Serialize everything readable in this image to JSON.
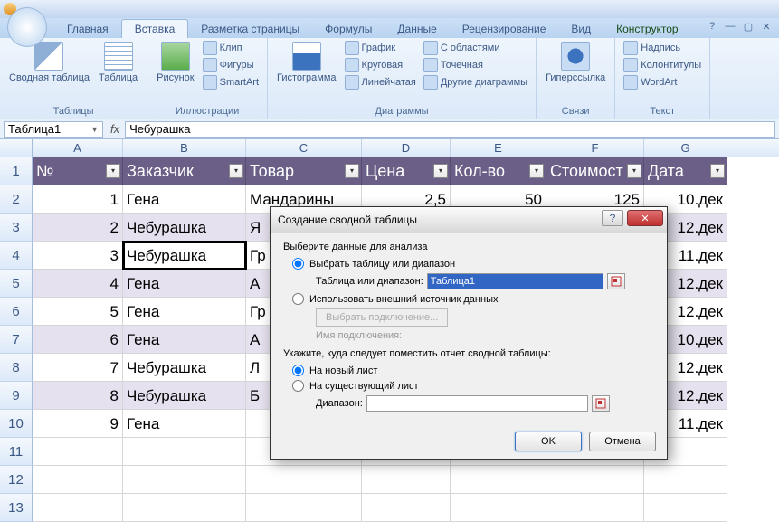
{
  "tabs": [
    "Главная",
    "Вставка",
    "Разметка страницы",
    "Формулы",
    "Данные",
    "Рецензирование",
    "Вид",
    "Конструктор"
  ],
  "active_tab": 1,
  "ribbon": {
    "g1": {
      "label": "Таблицы",
      "pivot": "Сводная таблица",
      "table": "Таблица"
    },
    "g2": {
      "label": "Иллюстрации",
      "pic": "Рисунок",
      "clip": "Клип",
      "shapes": "Фигуры",
      "smart": "SmartArt"
    },
    "g3": {
      "label": "Диаграммы",
      "hist": "Гистограмма",
      "line": "График",
      "pie": "Круговая",
      "bar": "Линейчатая",
      "area": "С областями",
      "scatter": "Точечная",
      "other": "Другие диаграммы"
    },
    "g4": {
      "label": "Связи",
      "link": "Гиперссылка"
    },
    "g5": {
      "label": "Текст",
      "textbox": "Надпись",
      "headerfooter": "Колонтитулы",
      "wordart": "WordArt"
    }
  },
  "namebox": "Таблица1",
  "formula": "Чебурашка",
  "columns": [
    "A",
    "B",
    "C",
    "D",
    "E",
    "F",
    "G"
  ],
  "headers": [
    "№",
    "Заказчик",
    "Товар",
    "Цена",
    "Кол-во",
    "Стоимост",
    "Дата"
  ],
  "rows": [
    {
      "n": "1",
      "cust": "Гена",
      "prod": "Мандарины",
      "price": "2,5",
      "qty": "50",
      "cost": "125",
      "date": "10.дек"
    },
    {
      "n": "2",
      "cust": "Чебурашка",
      "prod": "Я",
      "price": "",
      "qty": "",
      "cost": "",
      "date": "12.дек"
    },
    {
      "n": "3",
      "cust": "Чебурашка",
      "prod": "Гр",
      "price": "",
      "qty": "",
      "cost": "",
      "date": "11.дек"
    },
    {
      "n": "4",
      "cust": "Гена",
      "prod": "А",
      "price": "",
      "qty": "",
      "cost": "",
      "date": "12.дек"
    },
    {
      "n": "5",
      "cust": "Гена",
      "prod": "Гр",
      "price": "",
      "qty": "",
      "cost": "",
      "date": "12.дек"
    },
    {
      "n": "6",
      "cust": "Гена",
      "prod": "А",
      "price": "",
      "qty": "",
      "cost": "",
      "date": "10.дек"
    },
    {
      "n": "7",
      "cust": "Чебурашка",
      "prod": "Л",
      "price": "",
      "qty": "",
      "cost": "",
      "date": "12.дек"
    },
    {
      "n": "8",
      "cust": "Чебурашка",
      "prod": "Б",
      "price": "",
      "qty": "",
      "cost": "",
      "date": "12.дек"
    },
    {
      "n": "9",
      "cust": "Гена",
      "prod": "",
      "price": "",
      "qty": "",
      "cost": "",
      "date": "11.дек"
    }
  ],
  "selected_cell": {
    "row": 3,
    "col": "B"
  },
  "dialog": {
    "title": "Создание сводной таблицы",
    "sect1": "Выберите данные для анализа",
    "opt_table": "Выбрать таблицу или диапазон",
    "range_lbl": "Таблица или диапазон:",
    "range_val": "Таблица1",
    "opt_ext": "Использовать внешний источник данных",
    "choose_conn": "Выбрать подключение...",
    "conn_name": "Имя подключения:",
    "sect2": "Укажите, куда следует поместить отчет сводной таблицы:",
    "opt_new": "На новый лист",
    "opt_exist": "На существующий лист",
    "range2_lbl": "Диапазон:",
    "range2_val": "",
    "ok": "OK",
    "cancel": "Отмена"
  }
}
